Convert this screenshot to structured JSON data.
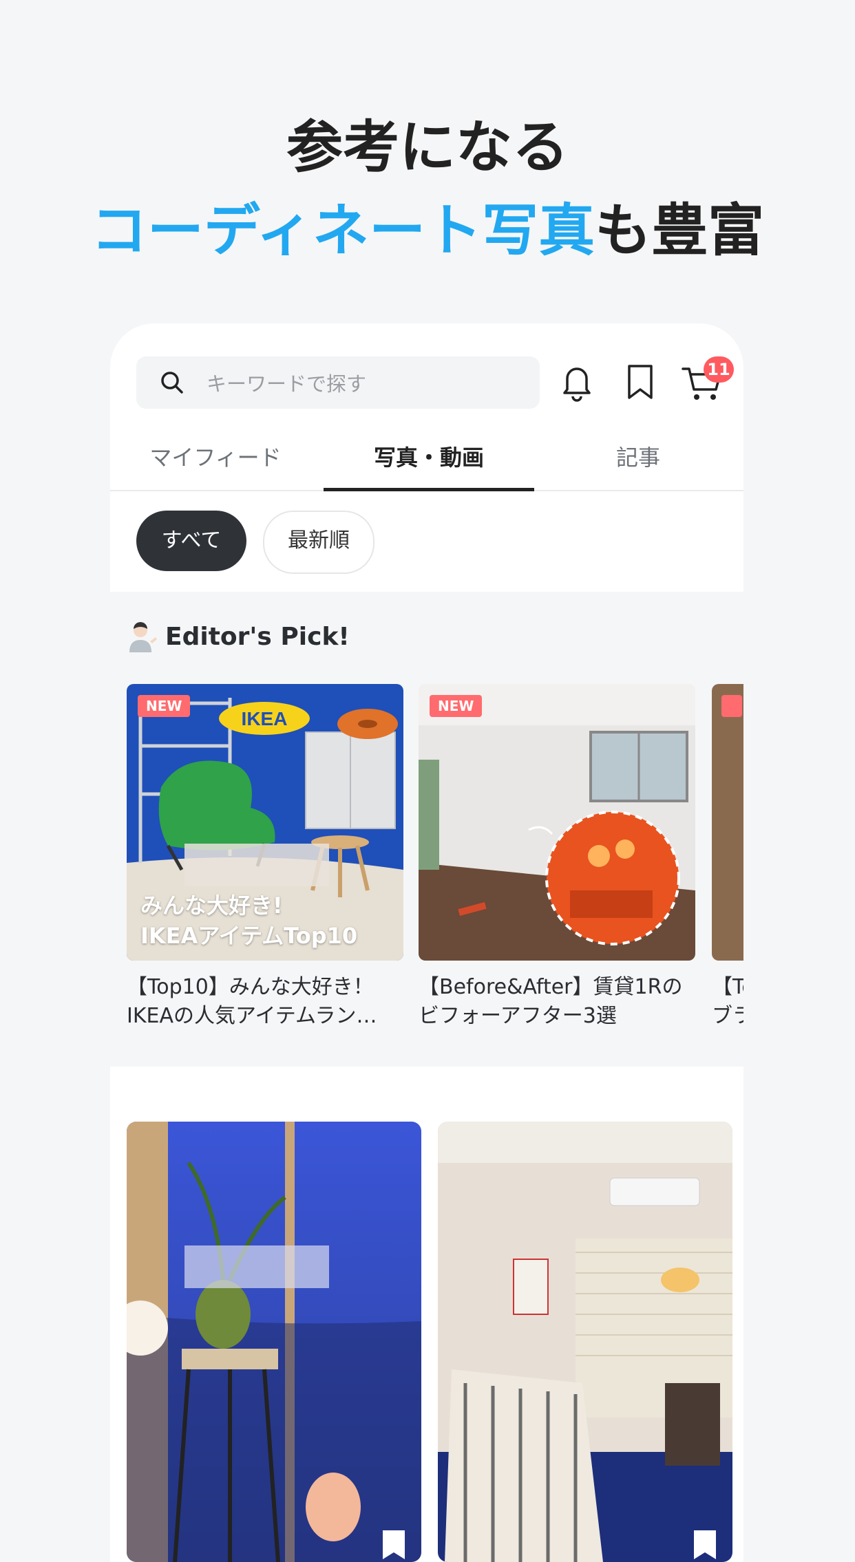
{
  "headline": {
    "line1": "参考になる",
    "line2_accent": "コーディネート写真",
    "line2_rest": "も豊富"
  },
  "topbar": {
    "search_placeholder": "キーワードで探す",
    "cart_badge": "11",
    "icons": [
      "search-icon",
      "bell-icon",
      "bookmark-icon",
      "cart-icon"
    ]
  },
  "tabs": [
    {
      "label": "マイフィード",
      "active": false
    },
    {
      "label": "写真・動画",
      "active": true
    },
    {
      "label": "記事",
      "active": false
    }
  ],
  "chips": [
    {
      "label": "すべて",
      "active": true
    },
    {
      "label": "最新順",
      "active": false
    }
  ],
  "editors_pick": {
    "title": "Editor's Pick!",
    "cards": [
      {
        "badge": "NEW",
        "logo": "IKEA",
        "overlay_line1": "みんな大好き!",
        "overlay_line2": "IKEAアイテムTop10",
        "caption_line1": "【Top10】みんな大好き！",
        "caption_line2": "IKEAの人気アイテムラン…"
      },
      {
        "badge": "NEW",
        "caption_line1": "【Before&After】賃貸1Rの",
        "caption_line2": "ビフォーアフター3選"
      },
      {
        "caption_line1": "【Tc",
        "caption_line2": "ブラ"
      }
    ]
  },
  "colors": {
    "accent": "#22a8f0",
    "badge": "#ff5a5f",
    "new_badge": "#ff6b6e",
    "chip_active": "#2f3338"
  }
}
